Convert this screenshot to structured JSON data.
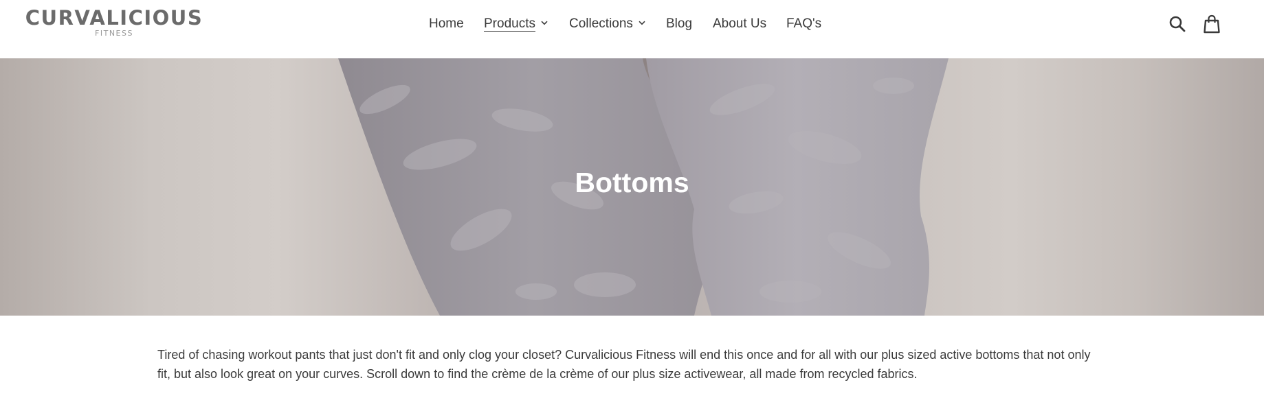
{
  "brand": {
    "name": "CURVALICIOUS",
    "tagline": "FITNESS"
  },
  "nav": {
    "items": [
      {
        "label": "Home",
        "has_dropdown": false,
        "active": false
      },
      {
        "label": "Products",
        "has_dropdown": true,
        "active": true
      },
      {
        "label": "Collections",
        "has_dropdown": true,
        "active": false
      },
      {
        "label": "Blog",
        "has_dropdown": false,
        "active": false
      },
      {
        "label": "About Us",
        "has_dropdown": false,
        "active": false
      },
      {
        "label": "FAQ's",
        "has_dropdown": false,
        "active": false
      }
    ]
  },
  "header_icons": {
    "search": "search-icon",
    "cart": "cart-icon"
  },
  "hero": {
    "title": "Bottoms"
  },
  "collection": {
    "description": "Tired of chasing workout pants that just don't fit and only clog your closet? Curvalicious Fitness will end this once and for all with our plus sized active bottoms that not only fit, but also look great on your curves. Scroll down to find the crème de la crème of our plus size activewear, all made from recycled fabrics."
  },
  "colors": {
    "text": "#3a3a3a",
    "logo": "#6b6b6b",
    "hero_title": "#ffffff",
    "hero_bg": "#bdb5b2",
    "leggings": "#a8a3aa"
  }
}
